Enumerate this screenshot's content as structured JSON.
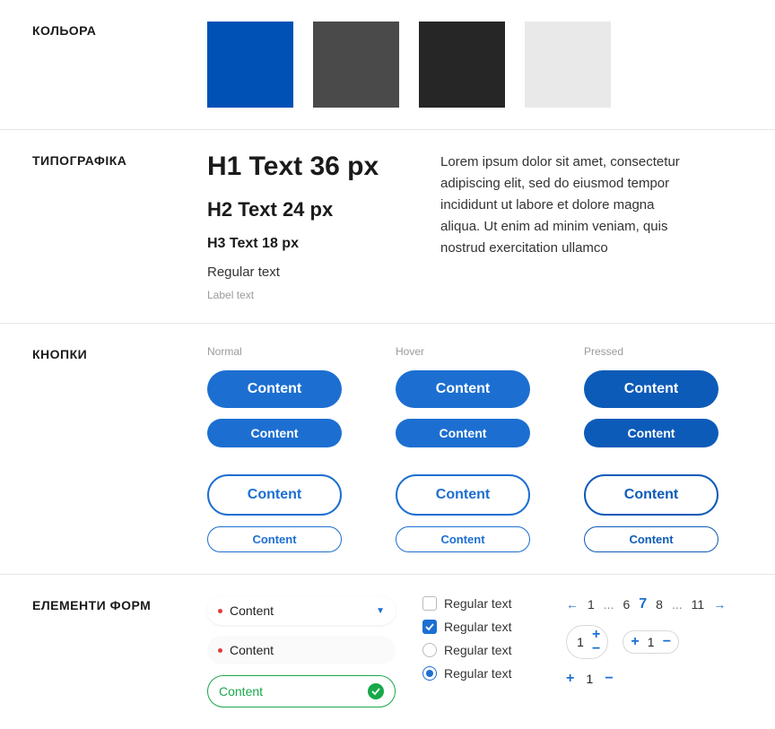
{
  "sections": {
    "colors": "КОЛЬОРА",
    "typography": "ТИПОГРАФІКА",
    "buttons": "КНОПКИ",
    "forms": "ЕЛЕМЕНТИ ФОРМ"
  },
  "colors": [
    {
      "name": "blue",
      "hex": "#0051b5"
    },
    {
      "name": "gray",
      "hex": "#4a4a4a"
    },
    {
      "name": "dark",
      "hex": "#262626"
    },
    {
      "name": "light",
      "hex": "#e9e9e9"
    }
  ],
  "typography": {
    "h1": "H1 Text 36 px",
    "h2": "H2 Text 24 px",
    "h3": "H3 Text 18 px",
    "regular": "Regular text",
    "label": "Label text",
    "paragraph": "Lorem ipsum dolor sit amet, consectetur adipiscing elit, sed do eiusmod tempor incididunt ut labore et dolore magna aliqua. Ut enim ad minim veniam, quis nostrud exercitation ullamco"
  },
  "buttons": {
    "states": {
      "normal": "Normal",
      "hover": "Hover",
      "pressed": "Pressed"
    },
    "label": "Content"
  },
  "forms": {
    "select": {
      "text": "Content"
    },
    "option_label": "Regular text",
    "pagination": {
      "pages": [
        "1",
        "...",
        "6",
        "7",
        "8",
        "...",
        "11"
      ],
      "active": "7"
    },
    "stepper_value": "1"
  }
}
